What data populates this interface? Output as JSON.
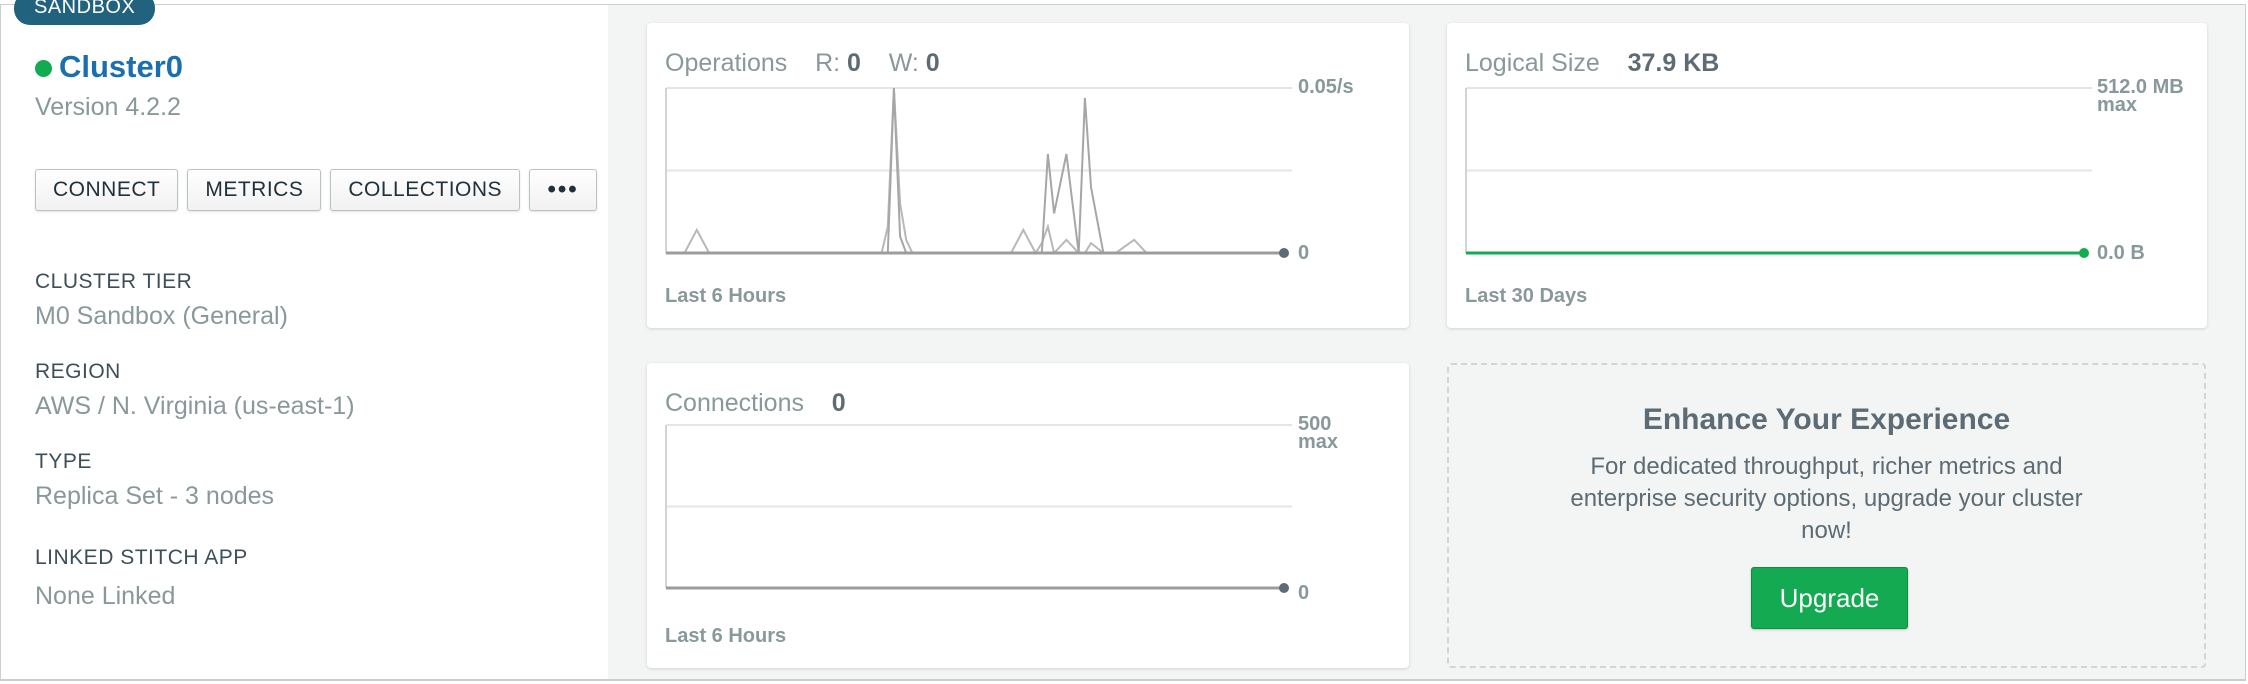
{
  "cluster": {
    "badge": "SANDBOX",
    "name": "Cluster0",
    "version": "Version 4.2.2",
    "status_color": "#13aa52"
  },
  "actions": {
    "connect": "CONNECT",
    "metrics": "METRICS",
    "collections": "COLLECTIONS",
    "more": "•••"
  },
  "details": [
    {
      "label": "CLUSTER TIER",
      "value": "M0 Sandbox (General)"
    },
    {
      "label": "REGION",
      "value": "AWS / N. Virginia (us-east-1)"
    },
    {
      "label": "TYPE",
      "value": "Replica Set - 3 nodes"
    },
    {
      "label": "LINKED STITCH APP",
      "value": "None Linked"
    }
  ],
  "operations": {
    "title": "Operations",
    "r_label": "R:",
    "r_value": "0",
    "w_label": "W:",
    "w_value": "0",
    "max_label": "0.05/s",
    "min_label": "0",
    "footer": "Last 6 Hours"
  },
  "logical_size": {
    "title": "Logical Size",
    "value": "37.9 KB",
    "max_label": "512.0 MB",
    "max_sub": "max",
    "min_label": "0.0 B",
    "footer": "Last 30 Days"
  },
  "connections": {
    "title": "Connections",
    "value": "0",
    "max_label": "500",
    "max_sub": "max",
    "min_label": "0",
    "footer": "Last 6 Hours"
  },
  "promo": {
    "title": "Enhance Your Experience",
    "body": "For dedicated throughput, richer metrics and enterprise security options, upgrade your cluster now!",
    "button": "Upgrade"
  },
  "chart_data": [
    {
      "type": "line",
      "title": "Operations",
      "ylim": [
        0,
        0.05
      ],
      "x": [
        0,
        0.03,
        0.05,
        0.07,
        0.35,
        0.36,
        0.37,
        0.38,
        0.39,
        0.4,
        0.41,
        0.42,
        0.56,
        0.58,
        0.6,
        0.61,
        0.62,
        0.63,
        0.65,
        0.67,
        0.68,
        0.69,
        0.71,
        0.73,
        0.76,
        0.78,
        0.8,
        0.82,
        1.0
      ],
      "series": [
        {
          "values": [
            0,
            0,
            0.007,
            0,
            0,
            0.008,
            0.05,
            0.015,
            0.004,
            0,
            0,
            0,
            0,
            0.007,
            0,
            0.003,
            0.008,
            0,
            0.004,
            0,
            0,
            0.003,
            0,
            0,
            0.004,
            0,
            0,
            0,
            0
          ]
        },
        {
          "values": [
            0,
            0,
            0,
            0,
            0,
            0,
            0.05,
            0.005,
            0,
            0,
            0,
            0,
            0,
            0,
            0,
            0,
            0.03,
            0.012,
            0.03,
            0,
            0.047,
            0.02,
            0,
            0,
            0,
            0,
            0,
            0,
            0
          ]
        }
      ]
    },
    {
      "type": "line",
      "title": "Logical Size",
      "ylim": [
        0,
        512.0
      ],
      "series": [
        {
          "values": [
            0,
            0
          ]
        }
      ]
    },
    {
      "type": "line",
      "title": "Connections",
      "ylim": [
        0,
        500
      ],
      "series": [
        {
          "values": [
            0,
            0
          ]
        }
      ]
    }
  ]
}
